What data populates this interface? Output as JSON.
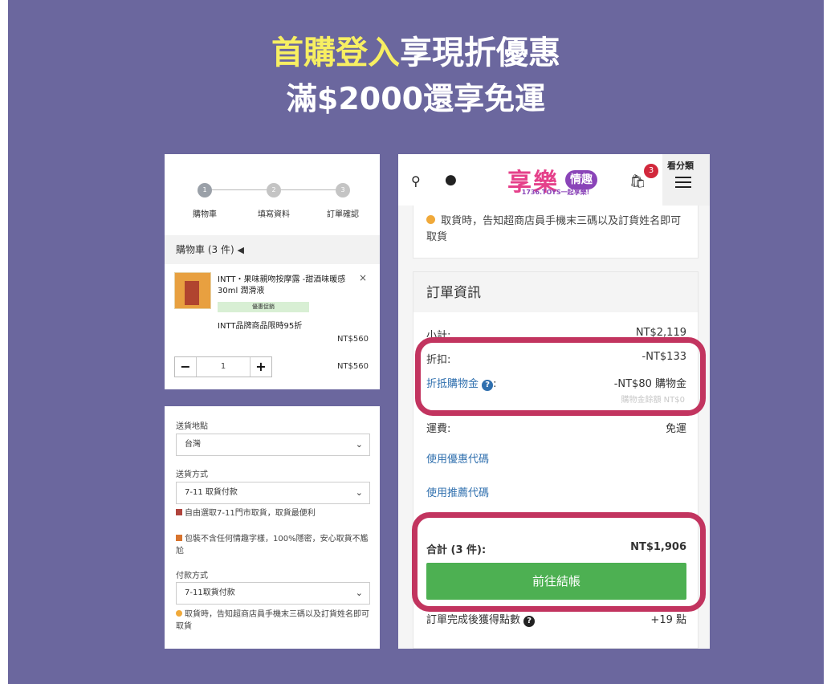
{
  "headline": {
    "highlight": "首購登入",
    "rest": "享現折優惠",
    "line2": "滿$2000還享免運"
  },
  "cart": {
    "steps": [
      {
        "number": "1",
        "label": "購物車"
      },
      {
        "number": "2",
        "label": "填寫資料"
      },
      {
        "number": "3",
        "label": "訂單確認"
      }
    ],
    "header": "購物車 (3 件)",
    "share_icon": "share-icon",
    "item": {
      "name": "INTT・果味親吻按摩露 -甜酒味暖感30ml 潤滑液",
      "promo_badge": "優惠促銷",
      "promo_text": "INTT品牌商品限時95折",
      "unit_price": "NT$560",
      "quantity": "1",
      "subtotal": "NT$560",
      "minus": "−",
      "plus": "+",
      "remove": "×"
    }
  },
  "shipping": {
    "destination_label": "送貨地點",
    "destination_value": "台灣",
    "method_label": "送貨方式",
    "method_value": "7-11 取貨付款",
    "method_note": "自由選取7-11門市取貨，取貨最便利",
    "privacy_note": "包裝不含任何情趣字樣，100%隱密，安心取貨不尷尬",
    "payment_label": "付款方式",
    "payment_value": "7-11取貨付款",
    "pickup_note": "取貨時，告知超商店員手機末三碼以及訂貨姓名即可取貨"
  },
  "mobile": {
    "logo_main": "享樂",
    "logo_pill": "情趣",
    "logo_sub": "1736.TOYS一起享樂!",
    "cart_count": "3",
    "category_label": "看分類",
    "pickup_note": "取貨時，告知超商店員手機末三碼以及訂貨姓名即可取貨",
    "order_info_title": "訂單資訊",
    "subtotal_label": "小計:",
    "subtotal_value": "NT$2,119",
    "discount_label": "折扣:",
    "discount_value": "-NT$133",
    "credit_label": "折抵購物金",
    "credit_colon": ":",
    "credit_value": "-NT$80 購物金",
    "credit_balance": "購物金餘額 NT$0",
    "shipping_label": "運費:",
    "shipping_value": "免運",
    "coupon_link": "使用優惠代碼",
    "referral_link": "使用推薦代碼",
    "total_label": "合計 (3 件):",
    "total_value": "NT$1,906",
    "checkout_button": "前往結帳",
    "points_label": "訂單完成後獲得點數",
    "points_value": "+19 點"
  },
  "colors": {
    "background": "#6b679e",
    "headline_highlight": "#f7ef62",
    "checkout_green": "#4db052",
    "highlight_ring": "#c2345f",
    "link_blue": "#2f6fae"
  }
}
